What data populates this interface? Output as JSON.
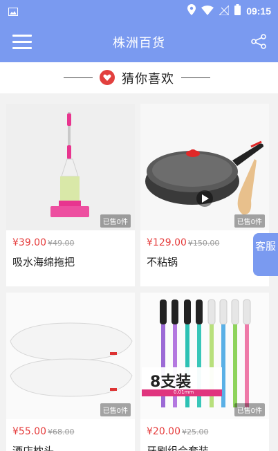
{
  "status_bar": {
    "time": "09:15",
    "icons": [
      "image-icon",
      "location-icon",
      "wifi-icon",
      "sim-icon",
      "battery-icon"
    ]
  },
  "app_bar": {
    "title": "株洲百货",
    "menu_icon": "hamburger-icon",
    "share_icon": "share-icon"
  },
  "section": {
    "title": "猜你喜欢",
    "icon": "heart-badge-icon"
  },
  "products": [
    {
      "price": "¥39.00",
      "old_price": "¥49.00",
      "name": "吸水海绵拖把",
      "sold": "已售0件"
    },
    {
      "price": "¥129.00",
      "old_price": "¥150.00",
      "name": "不粘锅",
      "sold": "已售0件"
    },
    {
      "price": "¥55.00",
      "old_price": "¥68.00",
      "name": "酒店枕头",
      "sold": "已售0件"
    },
    {
      "price": "¥20.00",
      "old_price": "¥25.00",
      "name": "牙刷组合套装",
      "sold": "已售0件"
    }
  ],
  "toothbrush_banner": {
    "text": "8支装",
    "subtext": "0.01mm"
  },
  "customer_service": {
    "label": "客服"
  },
  "colors": {
    "accent": "#7a9af0",
    "price": "#e53b3b"
  }
}
